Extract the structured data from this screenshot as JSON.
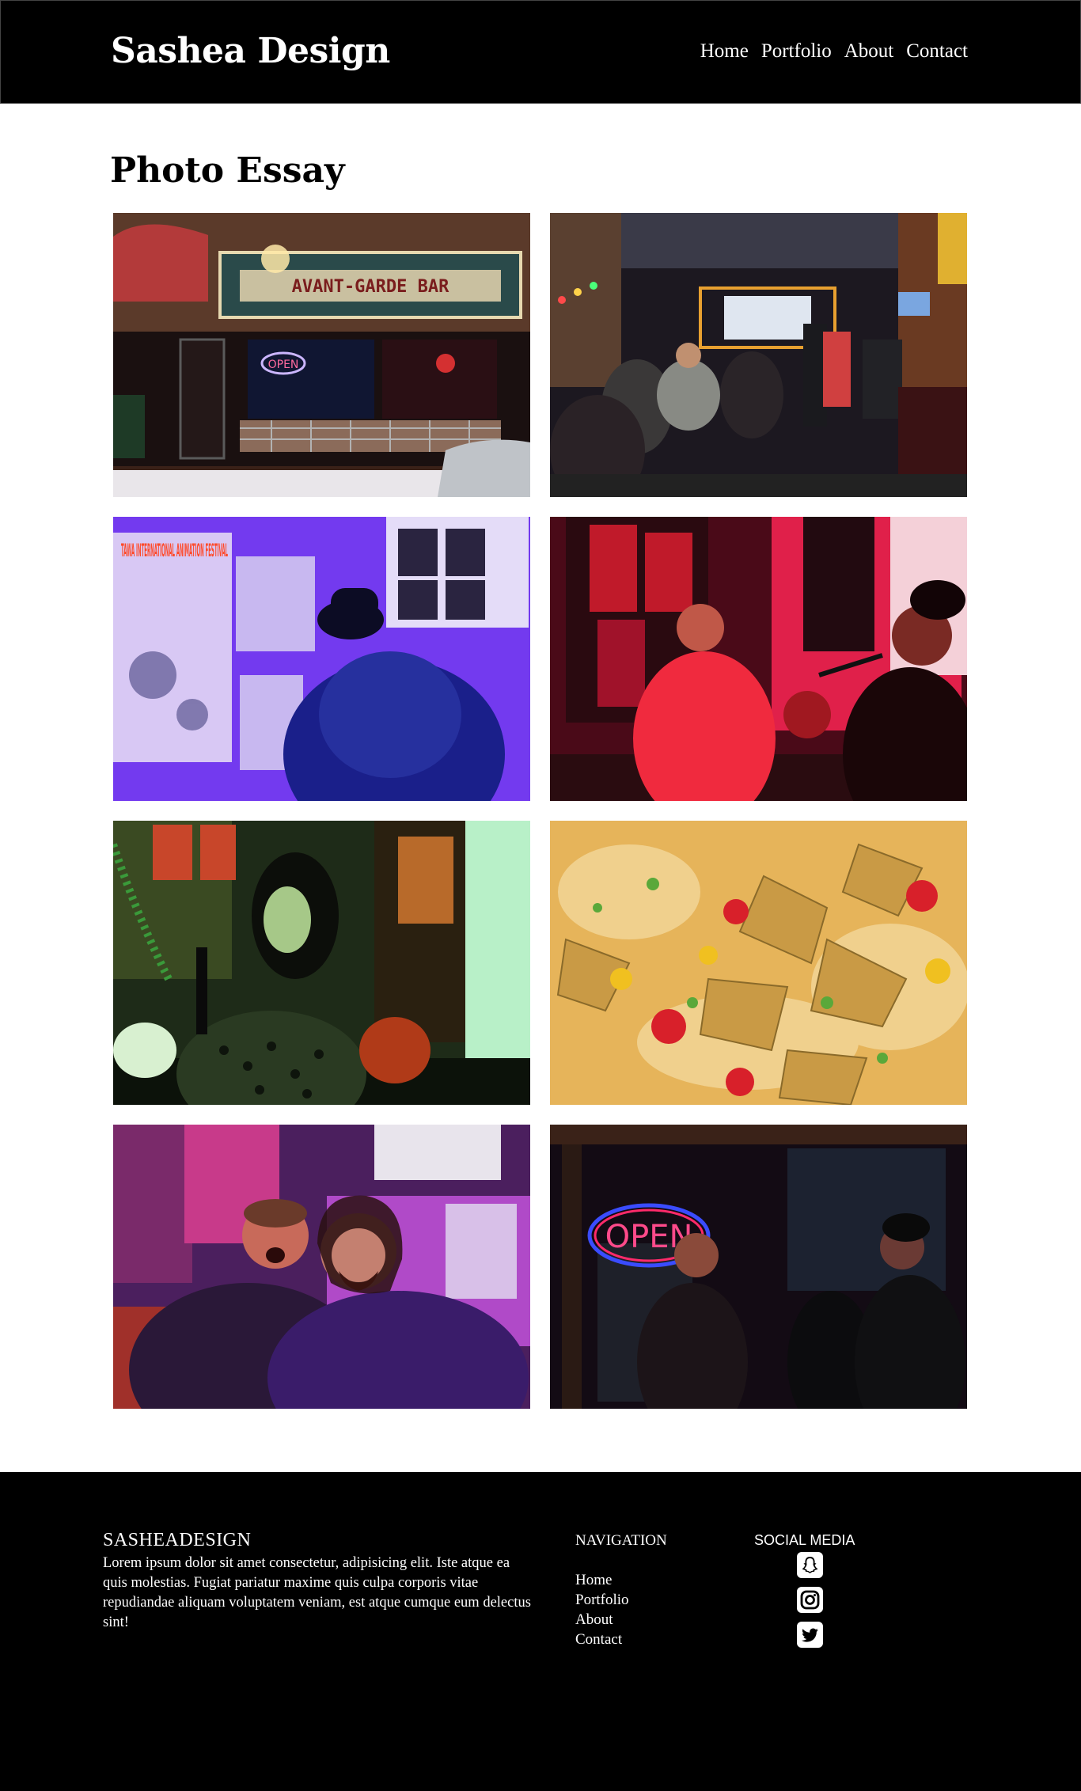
{
  "header": {
    "brand": "Sashea Design",
    "nav": [
      "Home",
      "Portfolio",
      "About",
      "Contact"
    ]
  },
  "main": {
    "title": "Photo Essay",
    "photos": [
      {
        "alt": "Avant-Garde Bar storefront at night",
        "sign_text": "AVANT-GARDE BAR",
        "neon": "OPEN"
      },
      {
        "alt": "Crowded bar interior"
      },
      {
        "alt": "Person in fur coat under blue light",
        "poster_text": "TAWA INTERNATIONAL ANIMATION FESTIVAL"
      },
      {
        "alt": "Two performers with microphones under red light"
      },
      {
        "alt": "Woman singing under green light"
      },
      {
        "alt": "Close-up of nachos"
      },
      {
        "alt": "Two men posing under purple light"
      },
      {
        "alt": "People by window with neon open sign",
        "neon": "OPEN"
      }
    ]
  },
  "footer": {
    "brand": "SASHEADESIGN",
    "text": "Lorem ipsum dolor sit amet consectetur, adipisicing elit. Iste atque ea quis molestias. Fugiat pariatur maxime quis culpa corporis vitae repudiandae aliquam voluptatem veniam, est atque cumque eum delectus sint!",
    "nav_heading": "NAVIGATION",
    "nav": [
      "Home",
      "Portfolio",
      "About",
      "Contact"
    ],
    "social_heading": "SOCIAL MEDIA",
    "social_icons": [
      "snapchat-icon",
      "instagram-icon",
      "twitter-icon"
    ]
  }
}
